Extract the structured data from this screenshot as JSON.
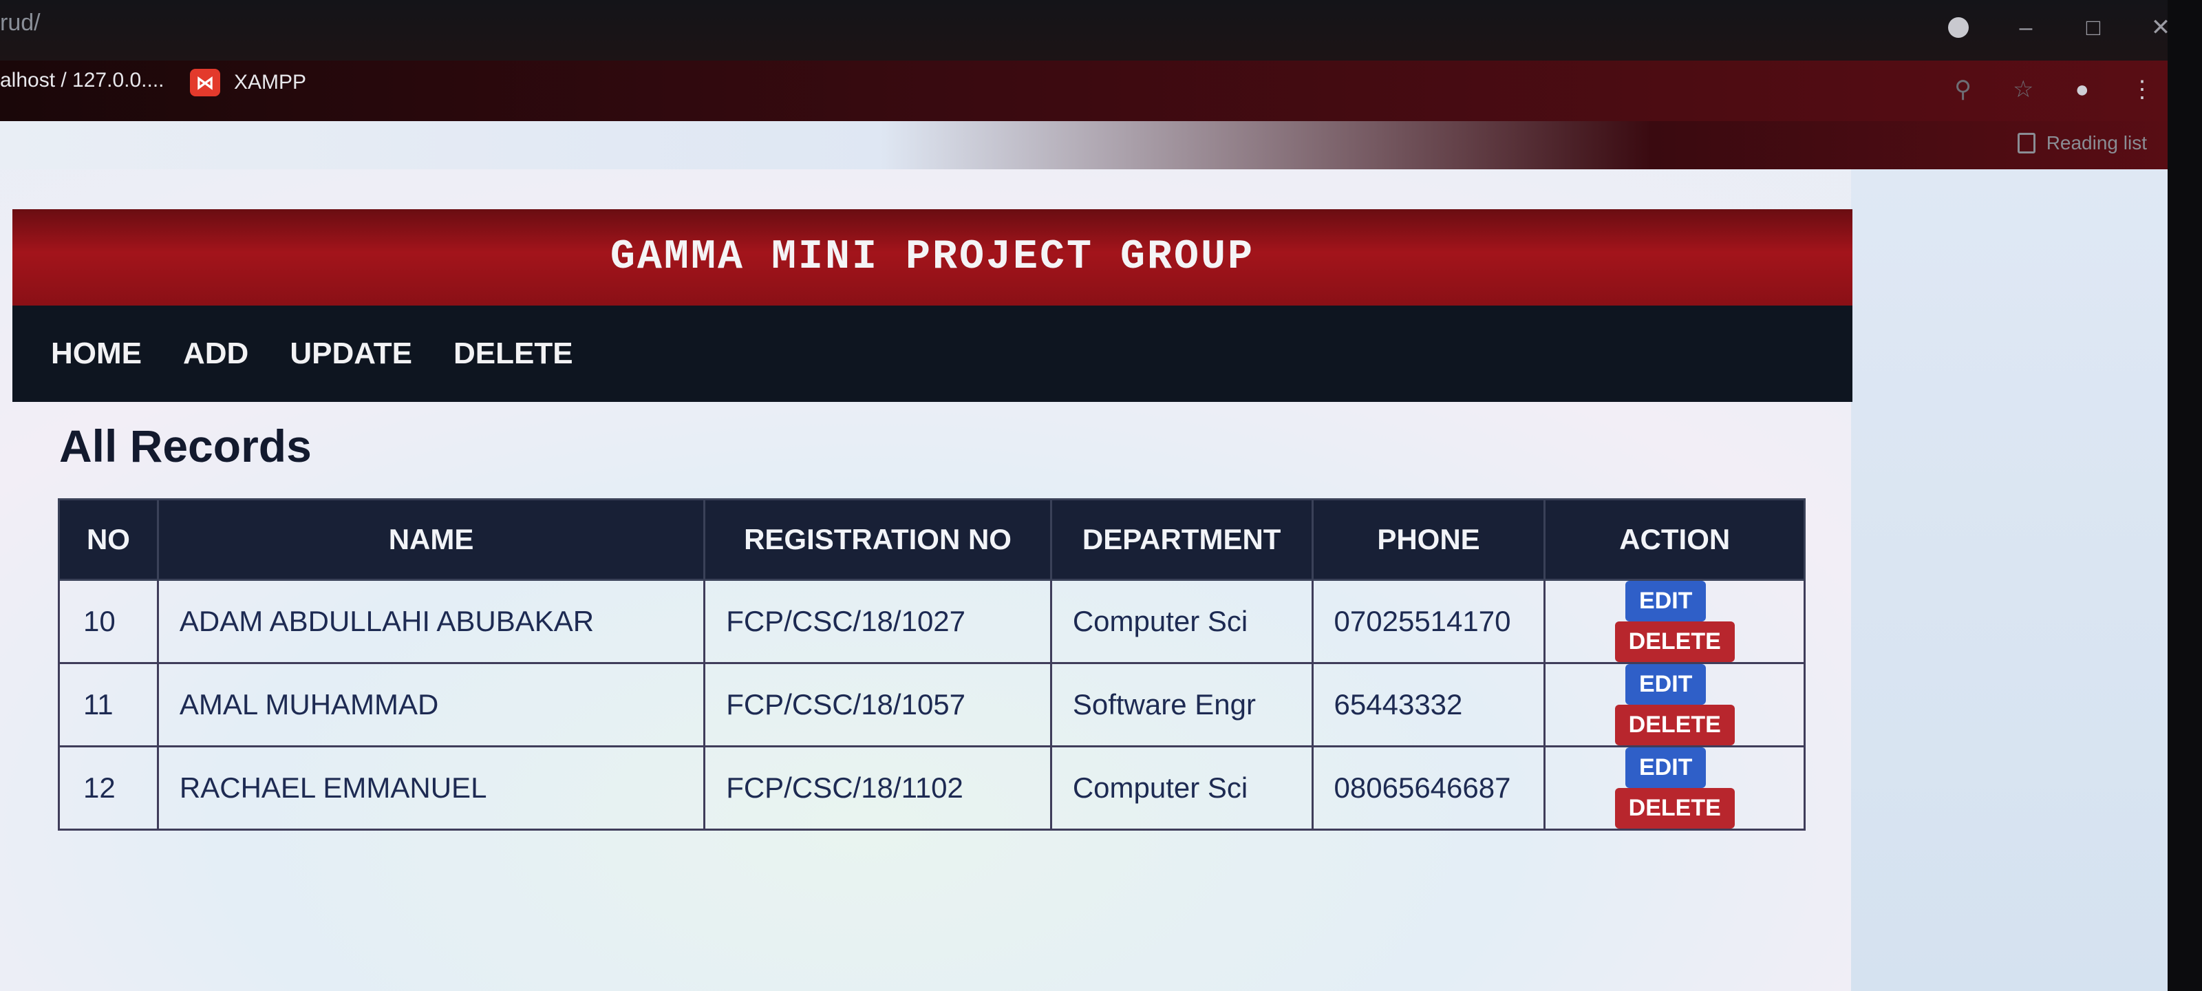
{
  "browser": {
    "url_fragment": "rud/",
    "bookmarks": [
      {
        "label": "alhost / 127.0.0...."
      },
      {
        "label": "XAMPP"
      }
    ],
    "reading_list": "Reading list"
  },
  "site": {
    "title": "GAMMA MINI PROJECT GROUP",
    "nav": [
      "HOME",
      "ADD",
      "UPDATE",
      "DELETE"
    ]
  },
  "records": {
    "heading": "All Records",
    "columns": [
      "NO",
      "NAME",
      "REGISTRATION NO",
      "DEPARTMENT",
      "PHONE",
      "ACTION"
    ],
    "rows": [
      {
        "no": "10",
        "name": "ADAM ABDULLAHI ABUBAKAR",
        "reg": "FCP/CSC/18/1027",
        "dept": "Computer Sci",
        "phone": "07025514170",
        "edit": "EDIT",
        "delete": "DELETE"
      },
      {
        "no": "11",
        "name": "AMAL MUHAMMAD",
        "reg": "FCP/CSC/18/1057",
        "dept": "Software Engr",
        "phone": "65443332",
        "edit": "EDIT",
        "delete": "DELETE"
      },
      {
        "no": "12",
        "name": "RACHAEL EMMANUEL",
        "reg": "FCP/CSC/18/1102",
        "dept": "Computer Sci",
        "phone": "08065646687",
        "edit": "EDIT",
        "delete": "DELETE"
      }
    ]
  },
  "colors": {
    "header_red": "#a3141b",
    "nav_dark": "#0e1520",
    "table_head": "#182036",
    "edit_blue": "#2f5fc8",
    "delete_red": "#b8262d"
  }
}
